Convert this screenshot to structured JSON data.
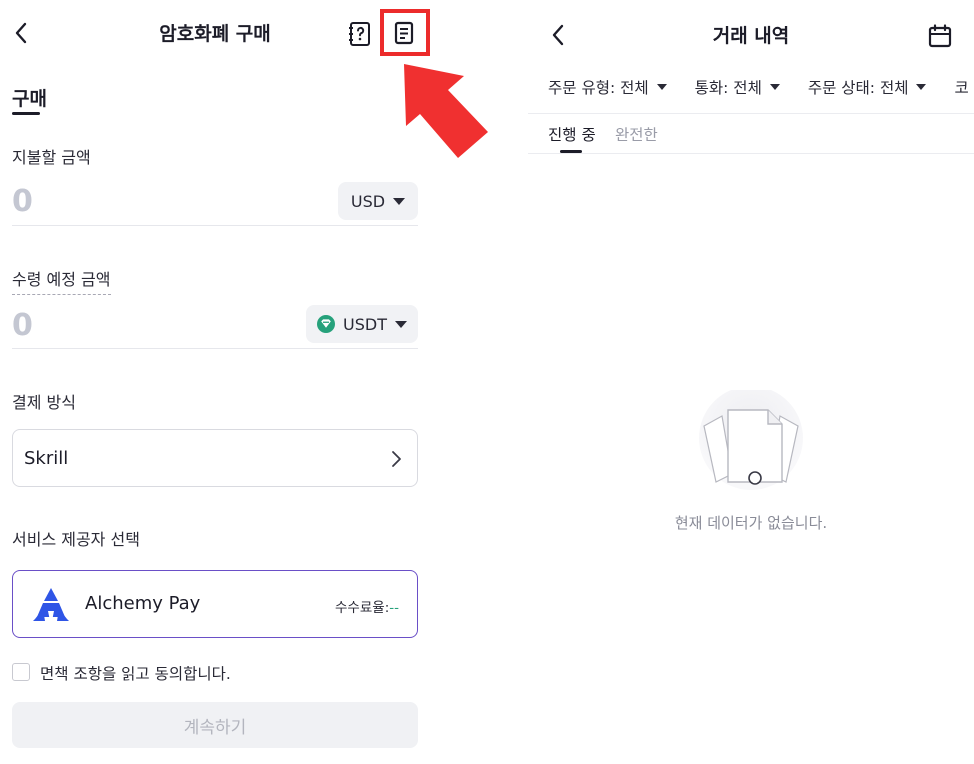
{
  "left_screen": {
    "header": {
      "title": "암호화폐 구매",
      "back_icon": "chevron-left-icon",
      "help_icon": "question-doc-icon",
      "orders_icon": "document-list-icon"
    },
    "tab_label": "구매",
    "pay_amount": {
      "label": "지불할 금액",
      "value": "0",
      "currency": "USD"
    },
    "receive_amount": {
      "label": "수령 예정 금액",
      "value": "0",
      "currency": "USDT",
      "currency_icon": "tether-icon"
    },
    "payment_method": {
      "label": "결제 방식",
      "value": "Skrill"
    },
    "provider": {
      "label": "서비스 제공자 선택",
      "name": "Alchemy Pay",
      "fee_label": "수수료율:",
      "fee_value": "--"
    },
    "agreement_text": "면책 조항을 읽고 동의합니다.",
    "continue_label": "계속하기"
  },
  "right_screen": {
    "header": {
      "title": "거래 내역",
      "calendar_icon": "calendar-icon"
    },
    "filters": [
      {
        "label": "주문 유형: 전체"
      },
      {
        "label": "통화: 전체"
      },
      {
        "label": "주문 상태: 전체"
      }
    ],
    "filter_overflow": "코",
    "tabs": [
      {
        "label": "진행 중"
      },
      {
        "label": "완전한"
      }
    ],
    "empty_text": "현재 데이터가 없습니다."
  },
  "colors": {
    "accent": "#6a4fc7",
    "highlight": "#ec2b2b",
    "tether": "#26a17b",
    "alchemy_blue": "#2f55e6"
  }
}
